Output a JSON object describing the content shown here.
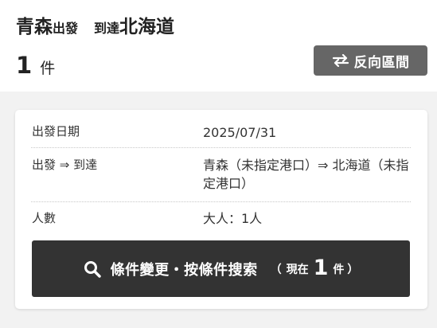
{
  "header": {
    "from_place": "青森",
    "from_suffix": "出發",
    "to_prefix": "到達",
    "to_place": "北海道",
    "count": "1",
    "count_unit": "件",
    "reverse_label": "反向區間"
  },
  "details": {
    "date_label": "出發日期",
    "date_value": "2025/07/31",
    "route_label": "出發 ⇒ 到達",
    "route_value": "青森（未指定港口）⇒ 北海道（未指定港口）",
    "people_label": "人數",
    "people_value": "大人：1人"
  },
  "search_button": {
    "label": "條件變更・按條件搜索",
    "paren_open": "（",
    "prefix": "現在",
    "count": "1",
    "unit": "件",
    "paren_close": "）"
  },
  "colors": {
    "reverse_button_bg": "#666666",
    "search_button_bg": "#333333",
    "page_gray": "#f2f2f2"
  },
  "icons": {
    "reverse": "swap-arrows-icon",
    "search": "search-icon"
  }
}
